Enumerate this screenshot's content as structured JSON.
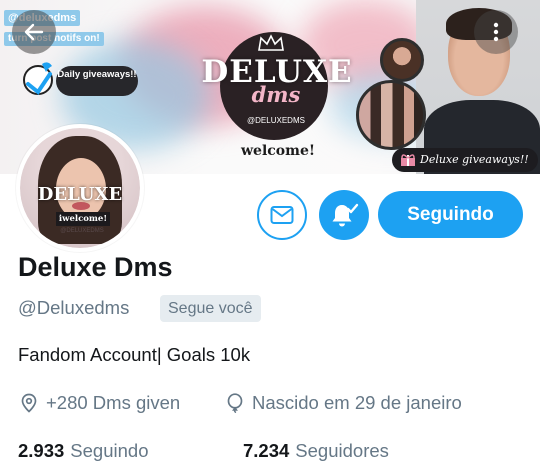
{
  "banner": {
    "handle_tag": "@deluxedms",
    "turn_tag": "turn post notifs on!",
    "daily_label": "Daily giveaways!!",
    "logo_title": "DELUXE",
    "logo_script": "dms",
    "logo_handle": "@DELUXEDMS",
    "welcome": "welcome!",
    "giveaway_label": "Deluxe giveaways!!"
  },
  "avatar": {
    "title": "DELUXE",
    "welcome": "iwelcome!",
    "handle": "@DELUXEDMS"
  },
  "actions": {
    "follow_label": "Seguindo"
  },
  "profile": {
    "name": "Deluxe Dms",
    "handle": "@Deluxedms",
    "follows_you": "Segue você",
    "bio": "Fandom Account| Goals 10k",
    "location": "+280 Dms given",
    "birthday": "Nascido em 29 de janeiro"
  },
  "stats": {
    "following_count": "2.933",
    "following_label": "Seguindo",
    "followers_count": "7.234",
    "followers_label": "Seguidores"
  },
  "colors": {
    "accent": "#1da1f2",
    "secondary_text": "#657786",
    "primary_text": "#14171a"
  }
}
